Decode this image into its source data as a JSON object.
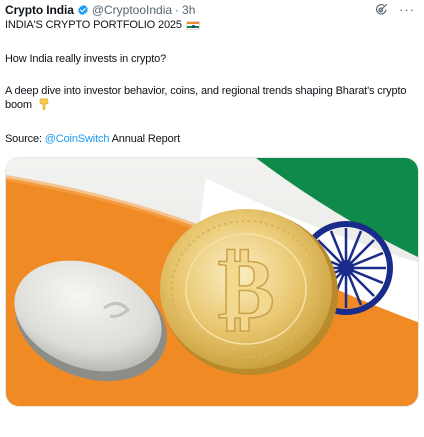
{
  "tweet": {
    "author_name": "Crypto India",
    "handle": "@CryptooIndia",
    "separator": "·",
    "time": "3h",
    "headline": "INDIA'S CRYPTO PORTFOLIO 2025",
    "question": "How India really invests in crypto?",
    "description": "A deep dive into investor behavior, coins, and regional trends shaping Bharat's crypto boom",
    "source_prefix": "Source: ",
    "source_mention": "@CoinSwitch",
    "source_suffix": " Annual Report",
    "more_label": "···"
  },
  "icons": {
    "verified": "verified-badge-icon",
    "grok": "grok-icon",
    "more": "more-icon",
    "flag": "india-flag-emoji",
    "pointing": "backhand-index-pointing-down-emoji"
  },
  "colors": {
    "text": "#0f1419",
    "secondary": "#536471",
    "link": "#1d9bf0",
    "verified": "#1d9bf0",
    "saffron": "#f08a24",
    "green": "#0a8a3a",
    "chakra": "#1a2c8a",
    "gold": "#e9c770"
  }
}
